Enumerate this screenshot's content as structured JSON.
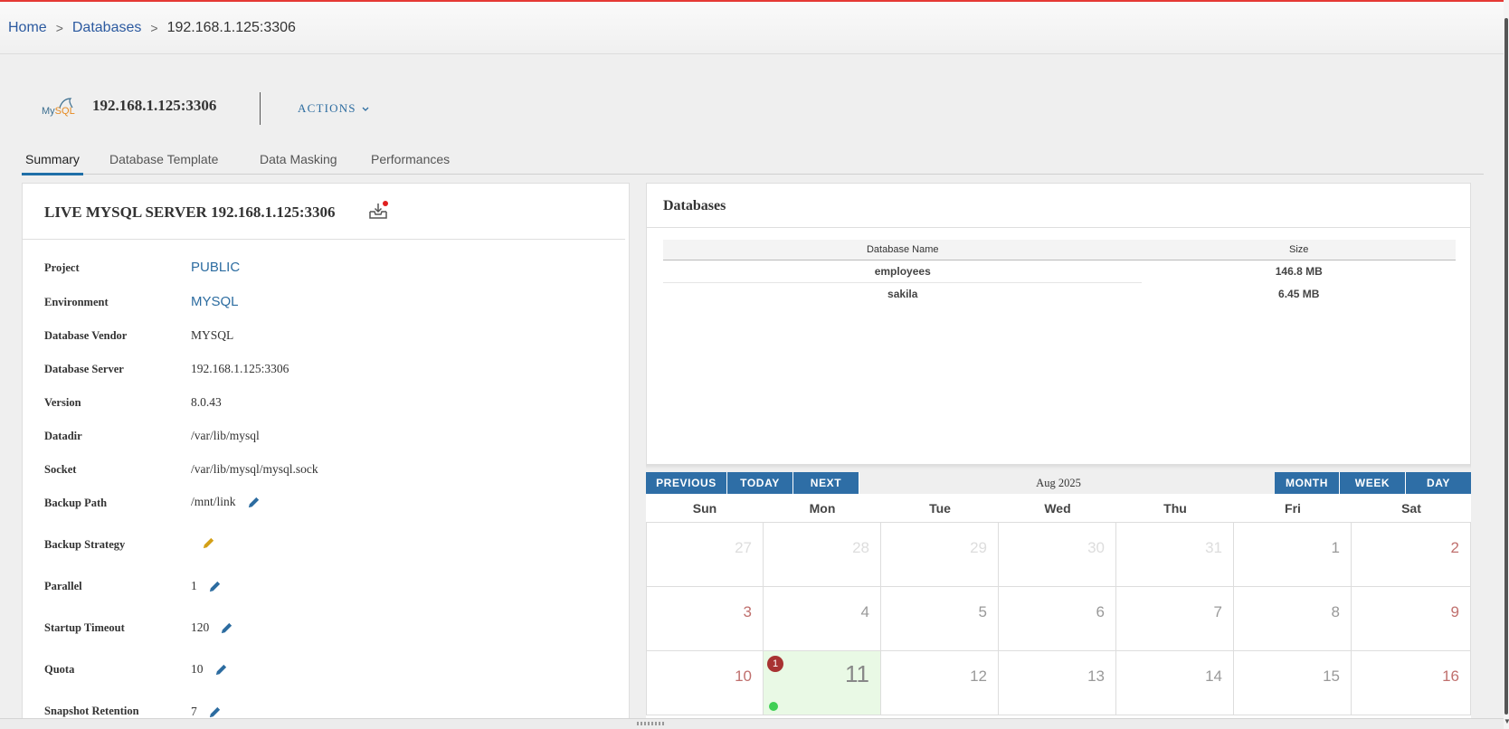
{
  "breadcrumb": {
    "home": "Home",
    "databases": "Databases",
    "current": "192.168.1.125:3306",
    "separator": ">"
  },
  "header": {
    "logo_my": "My",
    "logo_sql": "SQL",
    "title": "192.168.1.125:3306",
    "actions_label": "ACTIONS"
  },
  "tabs": [
    {
      "label": "Summary",
      "active": true
    },
    {
      "label": "Database Template",
      "active": false
    },
    {
      "label": "Data Masking",
      "active": false
    },
    {
      "label": "Performances",
      "active": false
    }
  ],
  "summary": {
    "title": "LIVE MYSQL SERVER 192.168.1.125:3306",
    "props": {
      "project": {
        "label": "Project",
        "value": "PUBLIC"
      },
      "environment": {
        "label": "Environment",
        "value": "MYSQL"
      },
      "vendor": {
        "label": "Database Vendor",
        "value": "MYSQL"
      },
      "server": {
        "label": "Database Server",
        "value": "192.168.1.125:3306"
      },
      "version": {
        "label": "Version",
        "value": "8.0.43"
      },
      "datadir": {
        "label": "Datadir",
        "value": "/var/lib/mysql"
      },
      "socket": {
        "label": "Socket",
        "value": "/var/lib/mysql/mysql.sock"
      },
      "backup_path": {
        "label": "Backup Path",
        "value": "/mnt/link"
      },
      "backup_strategy": {
        "label": "Backup Strategy",
        "value": ""
      },
      "parallel": {
        "label": "Parallel",
        "value": "1"
      },
      "startup_timeout": {
        "label": "Startup Timeout",
        "value": "120"
      },
      "quota": {
        "label": "Quota",
        "value": "10"
      },
      "snapshot_retention": {
        "label": "Snapshot Retention",
        "value": "7"
      }
    }
  },
  "databases": {
    "title": "Databases",
    "columns": {
      "name": "Database Name",
      "size": "Size"
    },
    "rows": [
      {
        "name": "employees",
        "size": "146.8 MB"
      },
      {
        "name": "sakila",
        "size": "6.45 MB"
      }
    ]
  },
  "calendar": {
    "buttons": {
      "previous": "PREVIOUS",
      "today": "TODAY",
      "next": "NEXT",
      "month": "MONTH",
      "week": "WEEK",
      "day": "DAY"
    },
    "month_label": "Aug 2025",
    "days_of_week": [
      "Sun",
      "Mon",
      "Tue",
      "Wed",
      "Thu",
      "Fri",
      "Sat"
    ],
    "weeks": [
      [
        "27",
        "28",
        "29",
        "30",
        "31",
        "1",
        "2"
      ],
      [
        "3",
        "4",
        "5",
        "6",
        "7",
        "8",
        "9"
      ],
      [
        "10",
        "11",
        "12",
        "13",
        "14",
        "15",
        "16"
      ]
    ],
    "today_badge": "1"
  },
  "colors": {
    "accent": "#2e6ea6",
    "link": "#2c6ca0",
    "edit_icon": "#2c6ca0",
    "edit_icon_alt": "#d4a017",
    "today_bg": "#e9f9e5",
    "badge": "#a83232",
    "event_dot": "#3fcf54"
  }
}
